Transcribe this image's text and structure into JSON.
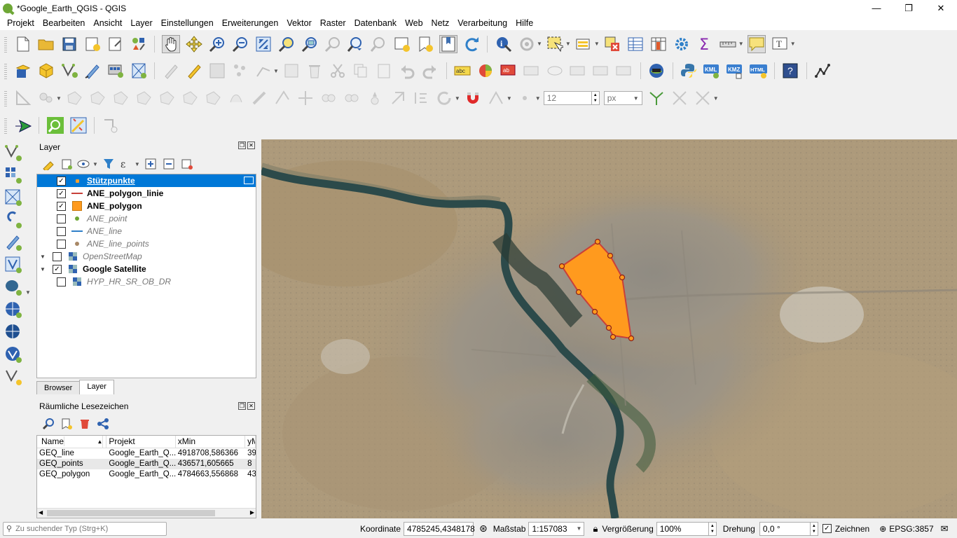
{
  "app": {
    "title": "*Google_Earth_QGIS - QGIS",
    "window_buttons": {
      "minimize": "—",
      "maximize": "❐",
      "close": "✕"
    }
  },
  "menu": [
    "Projekt",
    "Bearbeiten",
    "Ansicht",
    "Layer",
    "Einstellungen",
    "Erweiterungen",
    "Vektor",
    "Raster",
    "Datenbank",
    "Web",
    "Netz",
    "Verarbeitung",
    "Hilfe"
  ],
  "toolbar": {
    "snapping_tolerance": "12",
    "snapping_unit": "px",
    "icons_row3_labels": {
      "kml": "KML",
      "kmz": "KMZ",
      "html": "HTML"
    }
  },
  "layers_panel": {
    "title": "Layer",
    "items": [
      {
        "name": "Stützpunkte",
        "checked": true,
        "selected": true,
        "style": "selected"
      },
      {
        "name": "ANE_polygon_linie",
        "checked": true,
        "style": "bold"
      },
      {
        "name": "ANE_polygon",
        "checked": true,
        "style": "bold"
      },
      {
        "name": "ANE_point",
        "checked": false,
        "style": "italic"
      },
      {
        "name": "ANE_line",
        "checked": false,
        "style": "italic"
      },
      {
        "name": "ANE_line_points",
        "checked": false,
        "style": "italic"
      },
      {
        "name": "OpenStreetMap",
        "checked": false,
        "style": "italic"
      },
      {
        "name": "Google Satellite",
        "checked": true,
        "style": "bold"
      },
      {
        "name": "HYP_HR_SR_OB_DR",
        "checked": false,
        "style": "italic"
      }
    ],
    "tabs": [
      "Browser",
      "Layer"
    ],
    "check_mark": "✓"
  },
  "bookmarks_panel": {
    "title": "Räumliche Lesezeichen",
    "columns": [
      "Name",
      "Projekt",
      "xMin",
      "yM"
    ],
    "rows": [
      [
        "GEQ_line",
        "Google_Earth_Q...",
        "4918708,586366",
        "39"
      ],
      [
        "GEQ_points",
        "Google_Earth_Q...",
        "436571,605665",
        "8"
      ],
      [
        "GEQ_polygon",
        "Google_Earth_Q...",
        "4784663,556868",
        "43"
      ]
    ]
  },
  "statusbar": {
    "search_placeholder": "Zu suchender Typ (Strg+K)",
    "coord_label": "Koordinate",
    "coord_value": "4785245,4348178",
    "scale_label": "Maßstab",
    "scale_value": "1:157083",
    "magnifier_label": "Vergrößerung",
    "magnifier_value": "100%",
    "rotation_label": "Drehung",
    "rotation_value": "0,0 °",
    "render_label": "Zeichnen",
    "crs": "EPSG:3857"
  },
  "colors": {
    "selection": "#0078d7",
    "polygon_fill": "#ff9a1e",
    "polygon_stroke": "#c8403a"
  }
}
